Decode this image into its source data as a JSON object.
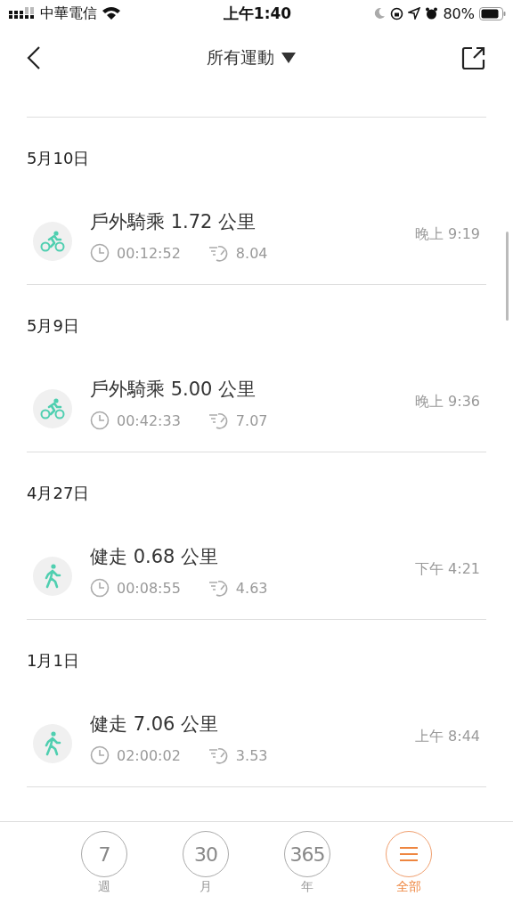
{
  "status_bar": {
    "carrier": "中華電信",
    "time": "上午1:40",
    "battery": "80%"
  },
  "nav": {
    "title": "所有運動"
  },
  "sections": [
    {
      "date": "5月10日",
      "activities": [
        {
          "kind": "cycling",
          "title": "戶外騎乘 1.72 公里",
          "duration": "00:12:52",
          "pace": "8.04",
          "time": "晚上 9:19"
        }
      ]
    },
    {
      "date": "5月9日",
      "activities": [
        {
          "kind": "cycling",
          "title": "戶外騎乘 5.00 公里",
          "duration": "00:42:33",
          "pace": "7.07",
          "time": "晚上 9:36"
        }
      ]
    },
    {
      "date": "4月27日",
      "activities": [
        {
          "kind": "walking",
          "title": "健走 0.68 公里",
          "duration": "00:08:55",
          "pace": "4.63",
          "time": "下午 4:21"
        }
      ]
    },
    {
      "date": "1月1日",
      "activities": [
        {
          "kind": "walking",
          "title": "健走 7.06 公里",
          "duration": "02:00:02",
          "pace": "3.53",
          "time": "上午 8:44"
        }
      ]
    }
  ],
  "tabs": [
    {
      "kind": "number",
      "value": "7",
      "label": "週",
      "selected": false
    },
    {
      "kind": "number",
      "value": "30",
      "label": "月",
      "selected": false
    },
    {
      "kind": "number",
      "value": "365",
      "label": "年",
      "selected": false
    },
    {
      "kind": "menu",
      "label": "全部",
      "selected": true
    }
  ]
}
